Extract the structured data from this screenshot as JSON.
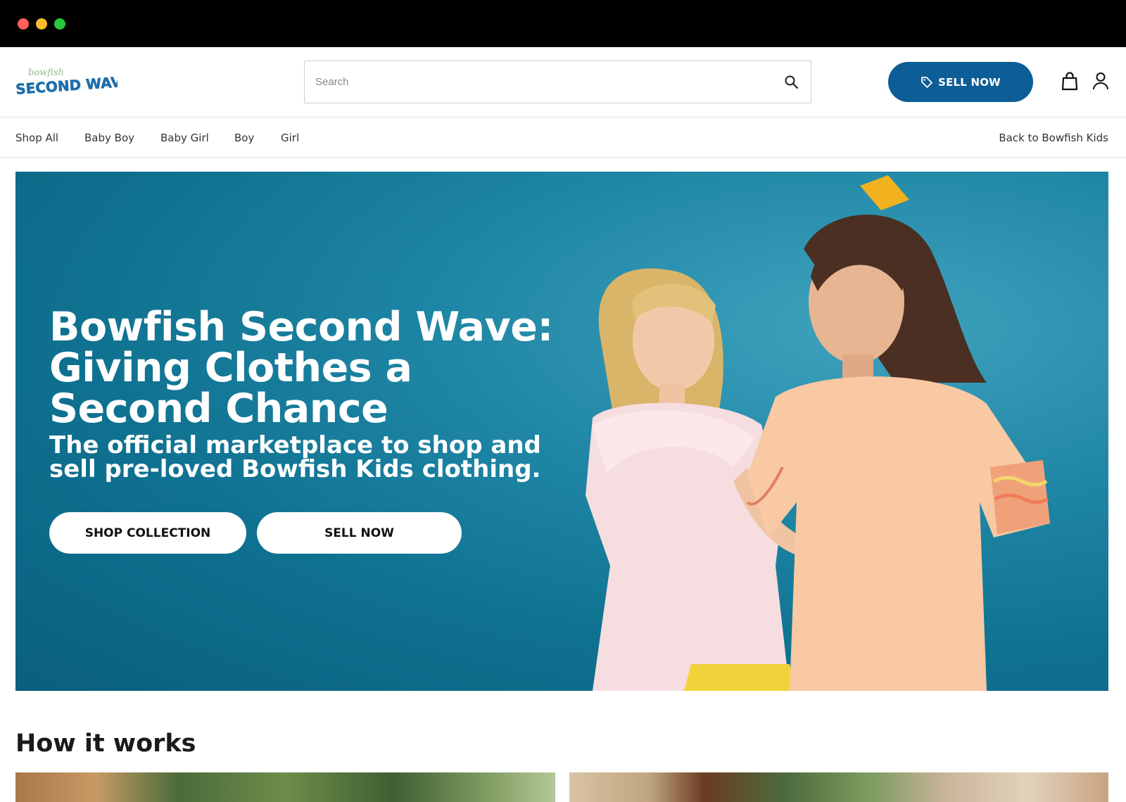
{
  "window": {
    "controls": [
      "close",
      "minimize",
      "maximize"
    ]
  },
  "header": {
    "logo": {
      "script_text": "bowfish",
      "main_text": "SECOND WAVE",
      "colors": {
        "blue": "#1f6ea8",
        "green": "#8fb88c"
      }
    },
    "search": {
      "placeholder": "Search",
      "value": "",
      "icon": "search-icon"
    },
    "sell_button": {
      "label": "SELL NOW",
      "icon": "tag-icon",
      "color": "#0d5d97"
    },
    "icons": {
      "bag": "shopping-bag-icon",
      "account": "user-icon"
    }
  },
  "nav": {
    "items": [
      {
        "label": "Shop All"
      },
      {
        "label": "Baby Boy"
      },
      {
        "label": "Baby Girl"
      },
      {
        "label": "Boy"
      },
      {
        "label": "Girl"
      }
    ],
    "back_link": "Back to Bowfish Kids"
  },
  "hero": {
    "title": "Bowfish Second Wave: Giving Clothes a Second Chance",
    "subtitle": "The official marketplace to shop and sell pre-loved Bowfish Kids clothing.",
    "buttons": {
      "shop": "SHOP COLLECTION",
      "sell": "SELL NOW"
    },
    "background_color": "#1a7f9f"
  },
  "how_it_works": {
    "title": "How it works"
  }
}
